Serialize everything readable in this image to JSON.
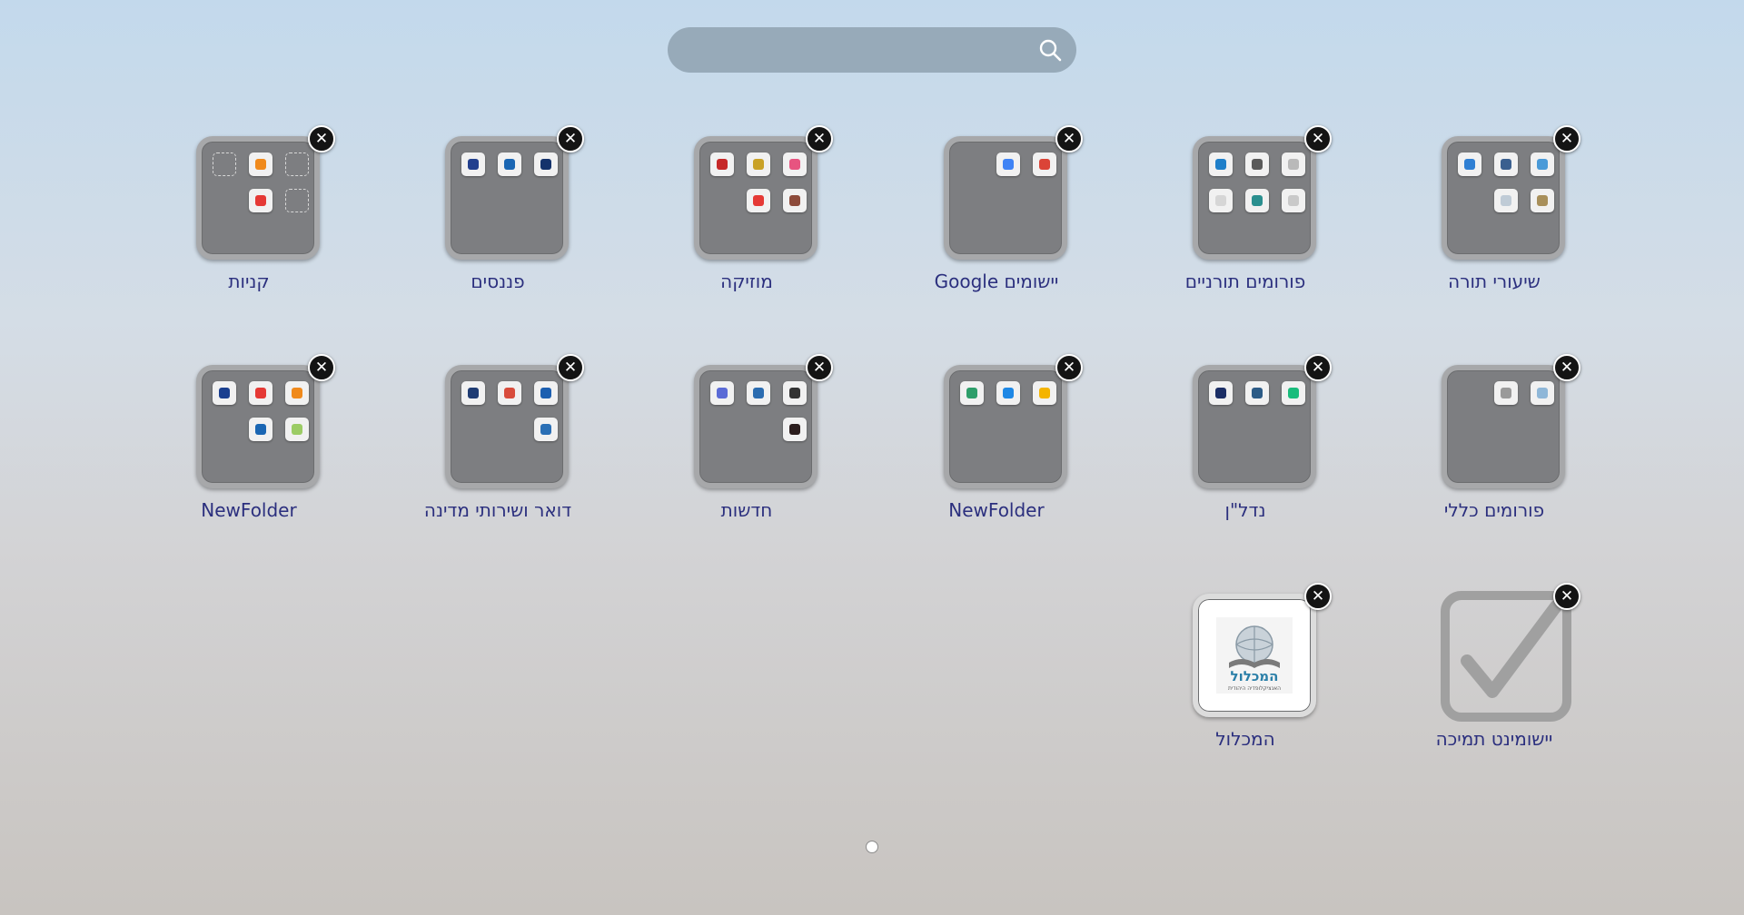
{
  "search": {
    "placeholder": ""
  },
  "folders": [
    {
      "label": "שיעורי תורה",
      "name": "folder-torah-lessons",
      "icons": [
        {
          "slot": 0,
          "color": "#2f7fd3"
        },
        {
          "slot": 1,
          "color": "#3a5f8f"
        },
        {
          "slot": 2,
          "color": "#4a9ad8"
        },
        {
          "slot": 4,
          "color": "#bfcbd6"
        },
        {
          "slot": 5,
          "color": "#a88f5a"
        }
      ]
    },
    {
      "label": "פורומים תורניים",
      "name": "folder-torah-forums",
      "icons": [
        {
          "slot": 0,
          "color": "#1f7fc9"
        },
        {
          "slot": 1,
          "color": "#5a5a5a"
        },
        {
          "slot": 2,
          "color": "#b9b9b9"
        },
        {
          "slot": 3,
          "color": "#d6d6d6"
        },
        {
          "slot": 4,
          "color": "#2a8f8f"
        },
        {
          "slot": 5,
          "color": "#c9c9c9"
        }
      ]
    },
    {
      "label": "יישומים Google",
      "name": "folder-google-apps",
      "icons": [
        {
          "slot": 1,
          "color": "#3f83f5"
        },
        {
          "slot": 2,
          "color": "#db4437"
        }
      ]
    },
    {
      "label": "מוזיקה",
      "name": "folder-music",
      "icons": [
        {
          "slot": 0,
          "color": "#c62828"
        },
        {
          "slot": 1,
          "color": "#c9a227"
        },
        {
          "slot": 2,
          "color": "#e75480"
        },
        {
          "slot": 4,
          "color": "#e53935"
        },
        {
          "slot": 5,
          "color": "#8d4b3a"
        }
      ]
    },
    {
      "label": "פננסים",
      "name": "folder-finance",
      "icons": [
        {
          "slot": 0,
          "color": "#23408e"
        },
        {
          "slot": 1,
          "color": "#1a66b3"
        },
        {
          "slot": 2,
          "color": "#14326b"
        }
      ]
    },
    {
      "label": "קניות",
      "name": "folder-shopping",
      "icons": [
        {
          "slot": 0,
          "empty": true
        },
        {
          "slot": 1,
          "color": "#f08a1c"
        },
        {
          "slot": 2,
          "empty": true
        },
        {
          "slot": 4,
          "color": "#e53935"
        },
        {
          "slot": 5,
          "empty": true
        }
      ]
    },
    {
      "label": "פורומים כללי",
      "name": "folder-general-forums",
      "icons": [
        {
          "slot": 1,
          "color": "#9a9a9a"
        },
        {
          "slot": 2,
          "color": "#8fb7d8"
        }
      ]
    },
    {
      "label": "נדל\"ן",
      "name": "folder-real-estate",
      "icons": [
        {
          "slot": 0,
          "color": "#1c2f66"
        },
        {
          "slot": 1,
          "color": "#2c5b86"
        },
        {
          "slot": 2,
          "color": "#1abc7c"
        }
      ]
    },
    {
      "label": "NewFolder",
      "name": "folder-newfolder-1",
      "icons": [
        {
          "slot": 0,
          "color": "#2e9e6a"
        },
        {
          "slot": 1,
          "color": "#1e88e5"
        },
        {
          "slot": 2,
          "color": "#f4b400"
        }
      ]
    },
    {
      "label": "חדשות",
      "name": "folder-news",
      "icons": [
        {
          "slot": 0,
          "color": "#5b6bd6"
        },
        {
          "slot": 1,
          "color": "#2b6cb0"
        },
        {
          "slot": 2,
          "color": "#333333"
        },
        {
          "slot": 5,
          "color": "#2b1d1d"
        }
      ]
    },
    {
      "label": "דואר ושירותי מדינה",
      "name": "folder-mail-gov",
      "icons": [
        {
          "slot": 0,
          "color": "#1f3c73"
        },
        {
          "slot": 1,
          "color": "#d84c3c"
        },
        {
          "slot": 2,
          "color": "#1c5fb0"
        },
        {
          "slot": 5,
          "color": "#2a6fb5"
        }
      ]
    },
    {
      "label": "NewFolder",
      "name": "folder-newfolder-2",
      "icons": [
        {
          "slot": 0,
          "color": "#1a3f8f"
        },
        {
          "slot": 1,
          "color": "#e53935"
        },
        {
          "slot": 2,
          "color": "#f08a1c"
        },
        {
          "slot": 4,
          "color": "#1a66b3"
        },
        {
          "slot": 5,
          "color": "#9ccc65"
        }
      ]
    }
  ],
  "apps": [
    {
      "label": "יישומינט תמיכה",
      "name": "app-yeshuminet-support",
      "icon": "checkmark-icon"
    },
    {
      "label": "המכלול",
      "name": "app-hamichlol",
      "icon": "hamichlol-logo-icon",
      "logo_text": "המכלול",
      "logo_subtext": "האנציקלופדיה היהודית"
    }
  ],
  "pager": {
    "current": 1,
    "total": 1
  },
  "close_symbol": "✕"
}
